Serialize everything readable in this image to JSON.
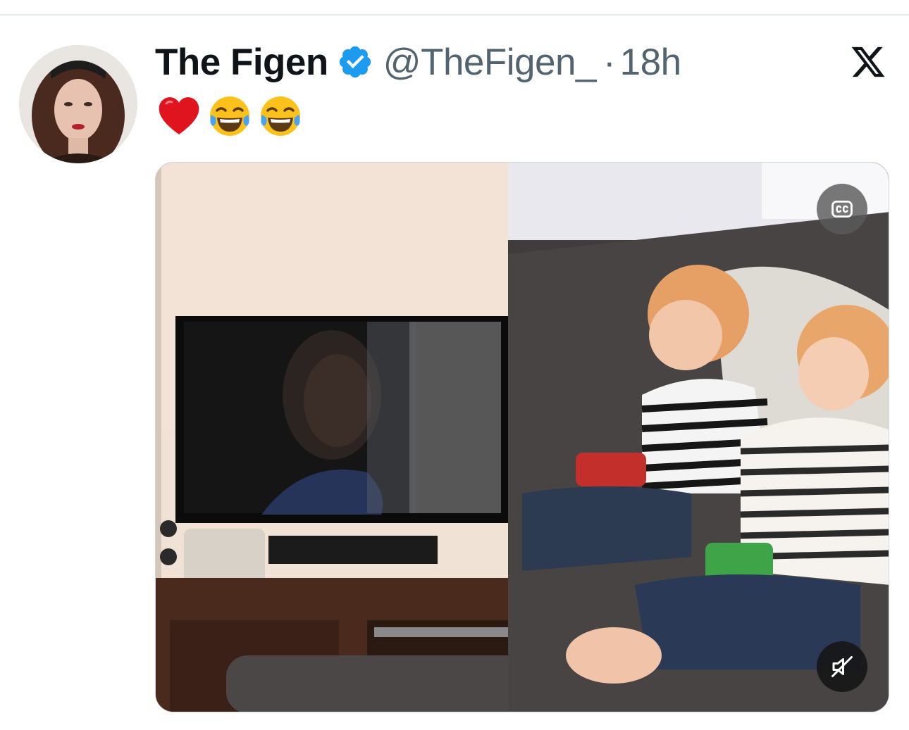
{
  "tweet": {
    "display_name": "The Figen",
    "handle": "@TheFigen_",
    "separator": "·",
    "timestamp": "18h",
    "verified": true,
    "emojis": [
      "red-heart",
      "face-with-tears-of-joy",
      "face-with-tears-of-joy"
    ]
  },
  "icons": {
    "verified": "verified-badge-icon",
    "brand": "x-logo-icon",
    "captions": "closed-captions-icon",
    "mute": "speaker-muted-icon"
  },
  "colors": {
    "verified_blue": "#1d9bf0",
    "name_text": "#0f1419",
    "secondary_text": "#536471",
    "divider": "#e4e8ea"
  }
}
